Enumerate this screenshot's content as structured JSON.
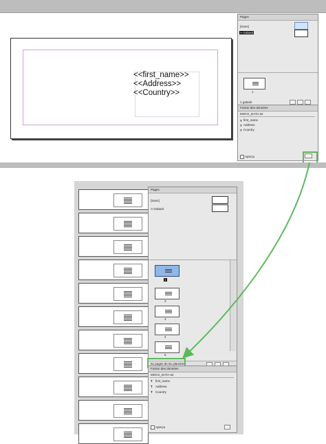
{
  "top": {
    "merge_fields": [
      "<<first_name>>",
      "<<Address>>",
      "<<Country>>"
    ],
    "pages_panel": {
      "tab_label": "Pages",
      "none_label": "[Sans]",
      "master_label": "A-Gabarit",
      "page_number": "1",
      "status": "1 gabarit"
    },
    "merge_panel": {
      "tab_label": "Fusion des données",
      "source_file": "MOCK_DATA.txt",
      "fields": [
        "first_name",
        "Address",
        "Country"
      ],
      "preview_label": "Aperçu"
    }
  },
  "bottom": {
    "pages_panel": {
      "tab_label": "Pages",
      "none_label": "[Sans]",
      "master_label": "A-Gabarit",
      "page_numbers": [
        "1",
        "2",
        "3",
        "4",
        "5"
      ],
      "status": "61 pages de 61 planches"
    },
    "merge_panel": {
      "tab_label": "Fusion des données",
      "source_file": "MOCK_DATA.txt",
      "fields": [
        "first_name",
        "Address",
        "Country"
      ],
      "preview_label": "Aperçu"
    }
  },
  "colors": {
    "arrow": "#5cb85c",
    "highlight": "#5cb85c",
    "selected_page": "#8fb8e8"
  }
}
